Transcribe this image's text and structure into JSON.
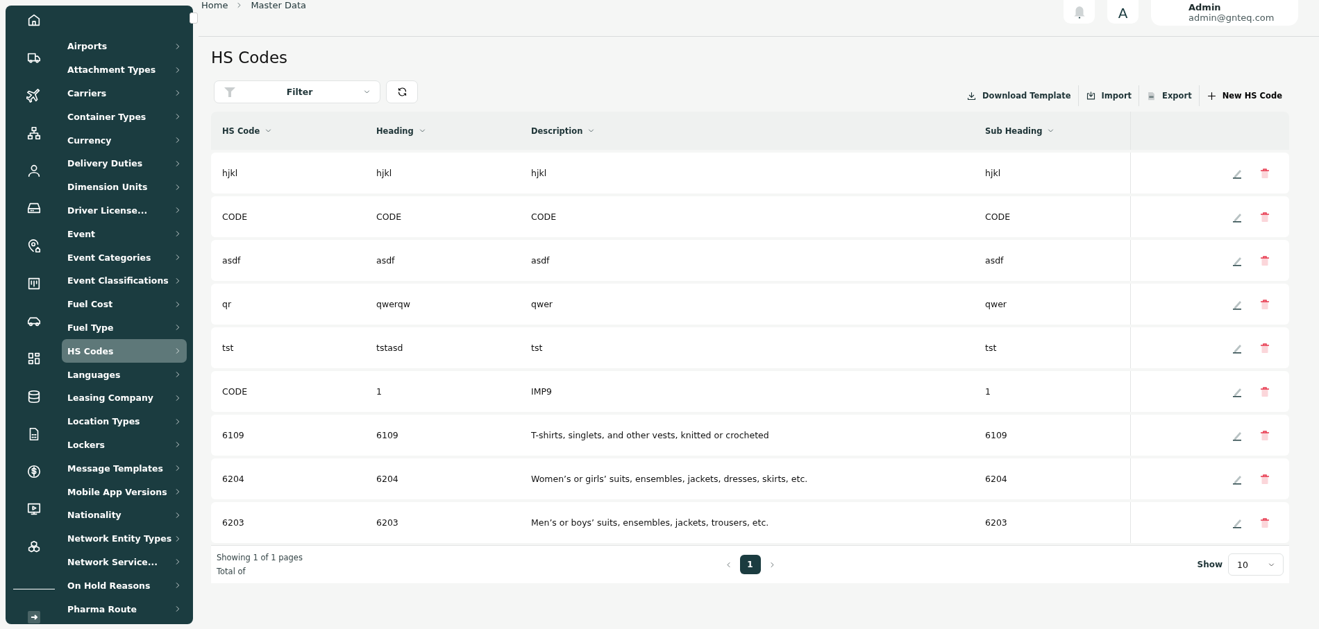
{
  "sidebar": {
    "menu": [
      {
        "label": "Airports",
        "selected": false
      },
      {
        "label": "Attachment Types",
        "selected": false
      },
      {
        "label": "Carriers",
        "selected": false
      },
      {
        "label": "Container Types",
        "selected": false
      },
      {
        "label": "Currency",
        "selected": false
      },
      {
        "label": "Delivery Duties",
        "selected": false
      },
      {
        "label": "Dimension Units",
        "selected": false
      },
      {
        "label": "Driver License...",
        "selected": false
      },
      {
        "label": "Event",
        "selected": false
      },
      {
        "label": "Event Categories",
        "selected": false
      },
      {
        "label": "Event Classifications",
        "selected": false
      },
      {
        "label": "Fuel Cost",
        "selected": false
      },
      {
        "label": "Fuel Type",
        "selected": false
      },
      {
        "label": "HS Codes",
        "selected": true
      },
      {
        "label": "Languages",
        "selected": false
      },
      {
        "label": "Leasing Company",
        "selected": false
      },
      {
        "label": "Location Types",
        "selected": false
      },
      {
        "label": "Lockers",
        "selected": false
      },
      {
        "label": "Message Templates",
        "selected": false
      },
      {
        "label": "Mobile App Versions",
        "selected": false
      },
      {
        "label": "Nationality",
        "selected": false
      },
      {
        "label": "Network Entity Types",
        "selected": false
      },
      {
        "label": "Network Service...",
        "selected": false
      },
      {
        "label": "On Hold Reasons",
        "selected": false
      },
      {
        "label": "Pharma Route",
        "selected": false
      }
    ]
  },
  "header": {
    "breadcrumb": [
      "Home",
      "Master Data"
    ],
    "language_button": "A",
    "user": {
      "name": "Admin",
      "email": "admin@gnteq.com"
    }
  },
  "page_title": "HS Codes",
  "filter": {
    "label": "Filter"
  },
  "actions": [
    {
      "kind": "download",
      "label": "Download Template"
    },
    {
      "kind": "import",
      "label": "Import"
    },
    {
      "kind": "export",
      "label": "Export"
    },
    {
      "kind": "new",
      "label": "New HS Code"
    }
  ],
  "table": {
    "columns": [
      "HS Code",
      "Heading",
      "Description",
      "Sub Heading"
    ],
    "rows": [
      [
        "hjkl",
        "hjkl",
        "hjkl",
        "hjkl"
      ],
      [
        "CODE",
        "CODE",
        "CODE",
        "CODE"
      ],
      [
        "asdf",
        "asdf",
        "asdf",
        "asdf"
      ],
      [
        "qr",
        "qwerqw",
        "qwer",
        "qwer"
      ],
      [
        "tst",
        "tstasd",
        "tst",
        "tst"
      ],
      [
        "CODE",
        "1",
        "IMP9",
        "1"
      ],
      [
        "6109",
        "6109",
        "T-shirts, singlets, and other vests, knitted or crocheted",
        "6109"
      ],
      [
        "6204",
        "6204",
        "Women’s or girls’ suits, ensembles, jackets, dresses, skirts, etc.",
        "6204"
      ],
      [
        "6203",
        "6203",
        "Men’s or boys’ suits, ensembles, jackets, trousers, etc.",
        "6203"
      ]
    ]
  },
  "footer": {
    "summary": "Showing 1 of 1 pages",
    "total": "Total of",
    "pages": [
      {
        "label": "1",
        "selected": true
      }
    ],
    "page_size_label": "Show",
    "page_size": "10"
  }
}
